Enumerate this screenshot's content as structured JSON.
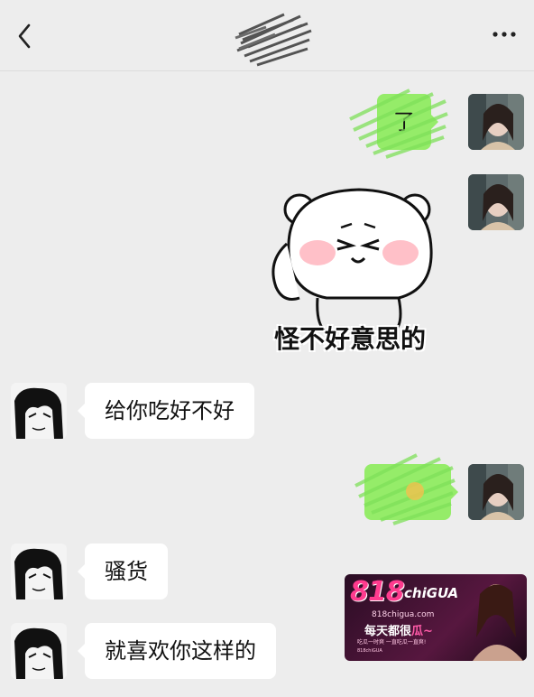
{
  "header": {
    "back_icon": "chevron-left-icon",
    "title_redacted": true,
    "more_icon": "ellipsis-icon"
  },
  "messages": [
    {
      "side": "right",
      "type": "text",
      "text": "了",
      "redacted": true
    },
    {
      "side": "right",
      "type": "sticker",
      "caption": "怪不好意思的"
    },
    {
      "side": "left",
      "type": "text",
      "text": "给你吃好不好"
    },
    {
      "side": "right",
      "type": "text",
      "text": "",
      "redacted": true
    },
    {
      "side": "left",
      "type": "text",
      "text": "骚货"
    },
    {
      "side": "left",
      "type": "text",
      "text": "就喜欢你这样的"
    }
  ],
  "watermark": {
    "logo_number": "818",
    "logo_text": "chiGUA",
    "domain": "818chigua.com",
    "slogan_prefix": "每天都很",
    "slogan_accent": "瓜~",
    "line1": "吃瓜一时爽 一直吃瓜一直爽!",
    "line2": "818chiGUA"
  },
  "colors": {
    "background": "#ededed",
    "bubble_sent": "#95ec69",
    "bubble_received": "#ffffff"
  }
}
